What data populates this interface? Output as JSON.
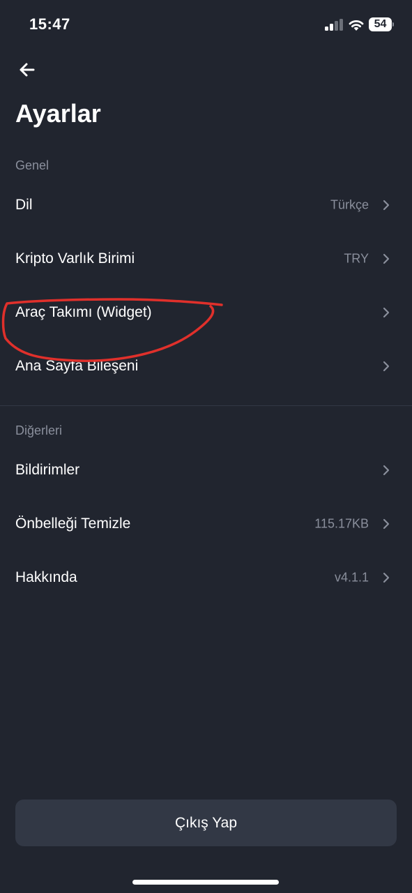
{
  "status_bar": {
    "time": "15:47",
    "battery": "54",
    "icons": [
      "cellular-signal-icon",
      "wifi-icon",
      "battery-icon"
    ]
  },
  "header": {
    "back_icon": "arrow-left-icon",
    "title": "Ayarlar"
  },
  "sections": [
    {
      "label": "Genel",
      "items": [
        {
          "label": "Dil",
          "value": "Türkçe"
        },
        {
          "label": "Kripto Varlık Birimi",
          "value": "TRY"
        },
        {
          "label": "Araç Takımı (Widget)",
          "value": ""
        },
        {
          "label": "Ana Sayfa Bileşeni",
          "value": ""
        }
      ]
    },
    {
      "label": "Diğerleri",
      "items": [
        {
          "label": "Bildirimler",
          "value": ""
        },
        {
          "label": "Önbelleği Temizle",
          "value": "115.17KB"
        },
        {
          "label": "Hakkında",
          "value": "v4.1.1"
        }
      ]
    }
  ],
  "annotation": {
    "shape": "hand-drawn-circle",
    "color": "#e0302b",
    "target": "Araç Takımı (Widget)"
  },
  "logout": {
    "label": "Çıkış Yap"
  },
  "colors": {
    "background": "#21252f",
    "button_background": "#323845",
    "secondary_text": "#8a8f9c",
    "divider": "#323744"
  }
}
